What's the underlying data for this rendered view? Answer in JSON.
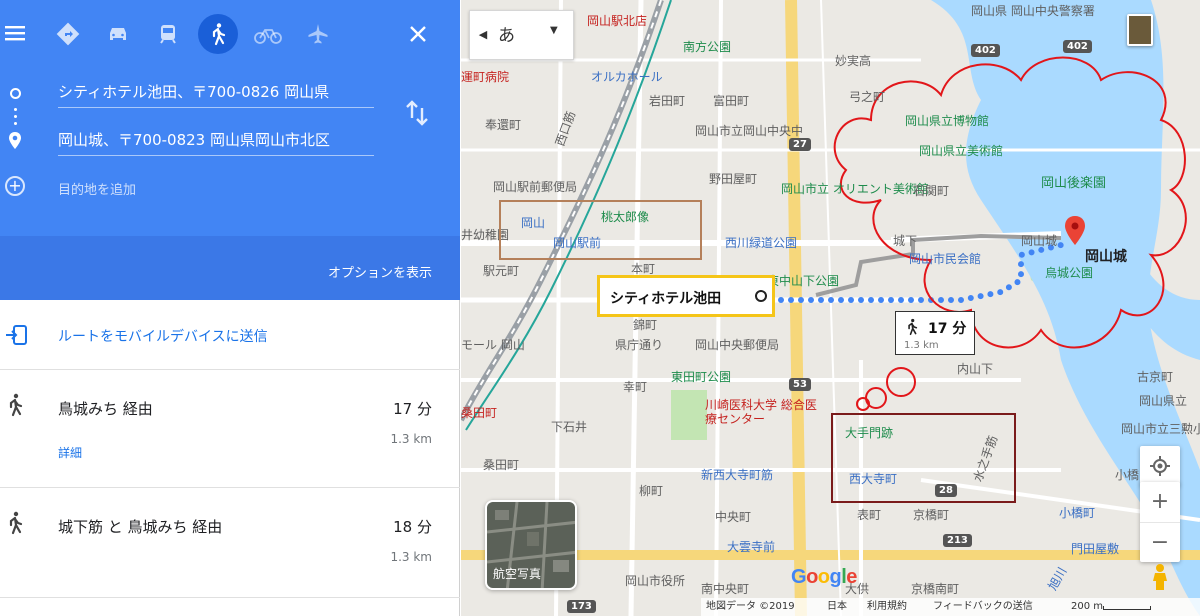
{
  "panel": {
    "modes": [
      "recommended",
      "car",
      "transit",
      "walking",
      "cycling",
      "flight"
    ],
    "active_mode": "walking",
    "origin": "シティホテル池田、〒700-0826 岡山県",
    "destination": "岡山城、〒700-0823 岡山県岡山市北区",
    "add_destination": "目的地を追加",
    "options_link": "オプションを表示",
    "send_to_mobile": "ルートをモバイルデバイスに送信",
    "routes": [
      {
        "via": "鳥城みち 経由",
        "time": "17 分",
        "distance": "1.3 km",
        "detail": "詳細"
      },
      {
        "via": "城下筋 と 鳥城みち 経由",
        "time": "18 分",
        "distance": "1.3 km"
      }
    ],
    "accent": "#4285f4"
  },
  "map": {
    "ime_char": "あ",
    "ime_collapse": "◀",
    "ime_dropdown": "▼",
    "labels": {
      "okayama_ekikita": "岡山駅北店",
      "minamigata_park": "南方公園",
      "okayama_pref_central_police": "岡山県 岡山中央警察署",
      "oruka_hall": "オルカホール",
      "ward_hospital": "運町病院",
      "iwadacho": "岩田町",
      "tomitacho": "富田町",
      "yumichou": "弓之町",
      "houjuin": "妙実高",
      "hoshimachi": "奉還町",
      "nishiguchi_st": "西口筋",
      "central_middle": "岡山市立岡山中央中",
      "museum": "岡山県立博物館",
      "art_museum": "岡山県立美術館",
      "post_office": "岡山駅前郵便局",
      "noda": "野田屋町",
      "orient_museum": "岡山市立 オリエント美術館",
      "ishizeki": "石関町",
      "korakuen": "岡山後楽園",
      "momotaro": "桃太郎像",
      "okayama_icon": "岡山",
      "ekimae_stop": "岡山駅前",
      "nishikawa_park": "西川緑道公園",
      "shiroshita": "城下",
      "civic_hall": "岡山市民会館",
      "okayamajo_small": "岡山城",
      "kindergarten": "井幼稚園",
      "honmachi": "本町",
      "ekimoto": "駅元町",
      "higashinakayama_park": "東中山下公園",
      "ujo_park": "烏城公園",
      "nishikicho": "錦町",
      "kencho": "県庁通り",
      "central_post": "岡山中央郵便局",
      "mall": "モール 岡山",
      "saiwaicho": "幸町",
      "higashida_park": "東田町公園",
      "kawasaki": "川崎医科大学 総合医療センター",
      "uchisange": "内山下",
      "kuwata": "桑田町",
      "shimoishii": "下石井",
      "otemon": "大手門跡",
      "mizunote": "水之手筋",
      "shinnishi": "新西大寺町筋",
      "nishidaiji": "西大寺町",
      "yanagi": "柳町",
      "omotecho": "表町",
      "kyobashi": "京橋町",
      "nakanocho": "中央町",
      "ohkumo": "大雲寺前",
      "city_hall": "岡山市役所",
      "nishinakajima": "南中央町",
      "odekyo": "大供",
      "kyobashi_minami": "京橋南町",
      "asahikawa": "旭川",
      "kobashi": "小橋町",
      "monden": "門田屋敷",
      "kozaka": "古京町",
      "okayama_pref": "岡山県立",
      "okayama_mitsu": "岡山市立三勲小",
      "kobashi2": "小橋",
      "aerial": "航空写真"
    },
    "road_numbers": [
      "402",
      "402",
      "27",
      "53",
      "28",
      "213",
      "173",
      "213"
    ],
    "callouts": {
      "hotel": "シティホテル池田",
      "walk_time": "17 分",
      "walk_distance": "1.3 km",
      "castle": "岡山城"
    },
    "footer": {
      "map_data": "地図データ ©2019",
      "country": "日本",
      "terms": "利用規約",
      "feedback": "フィードバックの送信",
      "scale": "200 m"
    },
    "zoom_in": "+",
    "zoom_out": "−",
    "google_letters": [
      "G",
      "o",
      "o",
      "g",
      "l",
      "e"
    ],
    "colors": {
      "route": "#4285f4",
      "water": "#aadaff",
      "park": "#c3e5b3",
      "annotation_red": "#e2161a",
      "hotel_box": "#f5c518",
      "station_box": "#b5805a",
      "gate_box": "#7a1b1b"
    }
  }
}
